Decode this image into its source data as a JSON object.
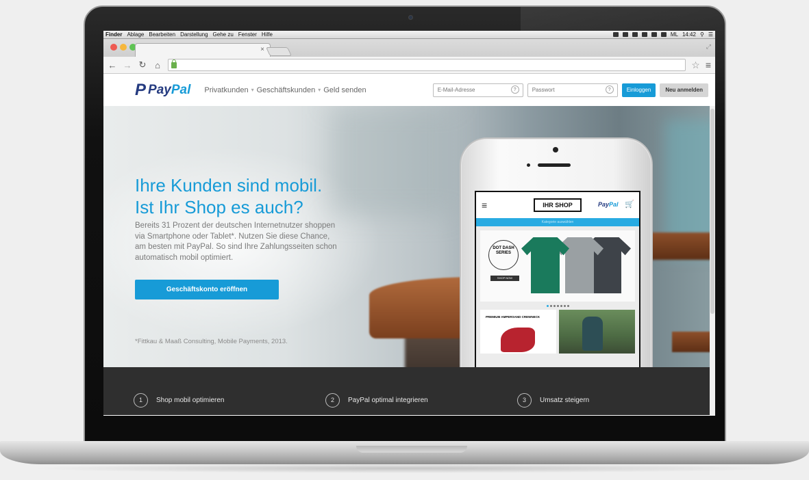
{
  "mac_menubar": {
    "app": "Finder",
    "items": [
      "Ablage",
      "Bearbeiten",
      "Darstellung",
      "Gehe zu",
      "Fenster",
      "Hilfe"
    ],
    "status_user": "ML",
    "clock": "14:42"
  },
  "browser": {
    "tab_close": "×",
    "address": ""
  },
  "paypal": {
    "logo_mark": "P",
    "logo_text_a": "Pay",
    "logo_text_b": "Pal",
    "nav": [
      "Privatkunden",
      "Geschäftskunden",
      "Geld senden"
    ],
    "email_placeholder": "E-Mail-Adresse",
    "password_placeholder": "Passwort",
    "help_glyph": "?",
    "login_button": "Einloggen",
    "signup_button": "Neu anmelden"
  },
  "hero": {
    "title_line1": "Ihre Kunden sind mobil.",
    "title_line2": "Ist Ihr Shop es auch?",
    "text": "Bereits 31 Prozent der deutschen Internetnutzer shoppen via Smartphone oder Tablet*. Nutzen Sie diese Chance, am besten mit PayPal. So sind Ihre Zahlungsseiten schon automatisch mobil optimiert.",
    "cta": "Geschäftskonto eröffnen",
    "footnote": "*Fittkau & Maaß Consulting, Mobile Payments, 2013."
  },
  "phone_shop": {
    "logo": "IHR SHOP",
    "paypal_a": "Pay",
    "paypal_b": "Pal",
    "category_bar": "Kategorie auswählen",
    "banner_label": "DOT DASH SERIES",
    "banner_button": "SHOP NOW",
    "tile1_label": "PREMIUM AMPERSAND CREWNECK"
  },
  "steps": [
    {
      "num": "1",
      "label": "Shop mobil optimieren"
    },
    {
      "num": "2",
      "label": "PayPal optimal integrieren"
    },
    {
      "num": "3",
      "label": "Umsatz steigern"
    }
  ],
  "colors": {
    "paypal_navy": "#253b80",
    "paypal_blue": "#179bd7",
    "steps_bg": "#2f2f2f"
  }
}
